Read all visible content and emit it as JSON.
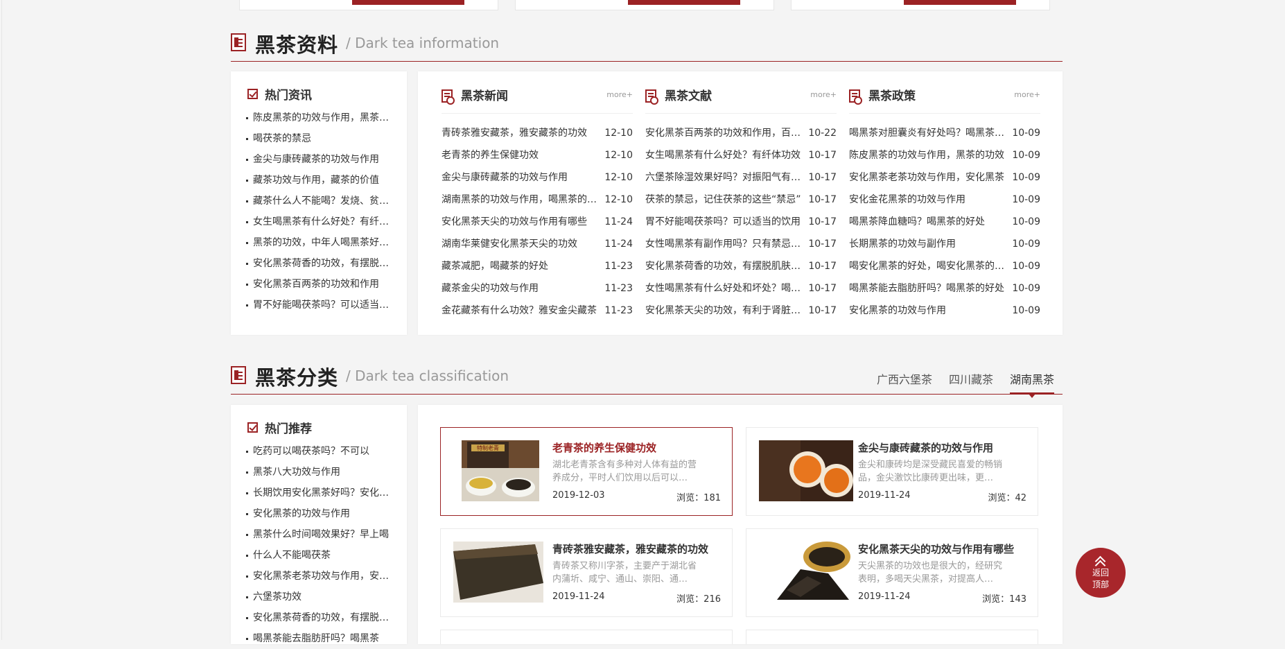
{
  "colors": {
    "accent": "#9b2224",
    "page_bg": "#f4f4f4",
    "muted": "#999999"
  },
  "info_section": {
    "title": "黑茶资料",
    "subtitle": "/ Dark tea information"
  },
  "hot_news": {
    "title": "热门资讯",
    "items": [
      "陈皮黑茶的功效与作用，黑茶怎么喝",
      "喝茯茶的禁忌",
      "金尖与康砖藏茶的功效与作用",
      "藏茶功效与作用，藏茶的价值",
      "藏茶什么人不能喝？发烧、贫血人群",
      "女生喝黑茶有什么好处？有纤体功效",
      "黑茶的功效，中年人喝黑茶好处多",
      "安化黑茶荷香的功效，有摆脱烦恼",
      "安化黑茶百两茶的功效和作用",
      "胃不好能喝茯茶吗？可以适当饮用"
    ]
  },
  "news_columns": [
    {
      "title": "黑茶新闻",
      "more": "more+",
      "items": [
        {
          "title": "青砖茶雅安藏茶，雅安藏茶的功效",
          "date": "12-10"
        },
        {
          "title": "老青茶的养生保健功效",
          "date": "12-10"
        },
        {
          "title": "金尖与康砖藏茶的功效与作用",
          "date": "12-10"
        },
        {
          "title": "湖南黑茶的功效与作用，喝黑茶的好处",
          "date": "12-10"
        },
        {
          "title": "安化黑茶天尖的功效与作用有哪些",
          "date": "11-24"
        },
        {
          "title": "湖南华莱健安化黑茶天尖的功效",
          "date": "11-24"
        },
        {
          "title": "藏茶减肥，喝藏茶的好处",
          "date": "11-23"
        },
        {
          "title": "藏茶金尖的功效与作用",
          "date": "11-23"
        },
        {
          "title": "金花藏茶有什么功效？雅安金尖藏茶",
          "date": "11-23"
        }
      ]
    },
    {
      "title": "黑茶文献",
      "more": "more+",
      "items": [
        {
          "title": "安化黑茶百两茶的功效和作用，百两茶",
          "date": "10-22"
        },
        {
          "title": "女生喝黑茶有什么好处？有纤体功效",
          "date": "10-17"
        },
        {
          "title": "六堡茶除湿效果好吗？对振阳气有帮助",
          "date": "10-17"
        },
        {
          "title": "茯茶的禁忌，记住茯茶的这些“禁忌”",
          "date": "10-17"
        },
        {
          "title": "胃不好能喝茯茶吗？可以适当的饮用",
          "date": "10-17"
        },
        {
          "title": "女性喝黑茶有副作用吗？只有禁忌人群",
          "date": "10-17"
        },
        {
          "title": "安化黑茶荷香的功效，有摆脱肌肤问题",
          "date": "10-17"
        },
        {
          "title": "女性喝黑茶有什么好处和坏处？喝黑茶",
          "date": "10-17"
        },
        {
          "title": "安化黑茶天尖的功效，有利于肾脏健康",
          "date": "10-17"
        }
      ]
    },
    {
      "title": "黑茶政策",
      "more": "more+",
      "items": [
        {
          "title": "喝黑茶对胆囊炎有好处吗？喝黑茶的好处",
          "date": "10-09"
        },
        {
          "title": "陈皮黑茶的功效与作用，黑茶的功效",
          "date": "10-09"
        },
        {
          "title": "安化黑茶老茶功效与作用，安化黑茶",
          "date": "10-09"
        },
        {
          "title": "安化金花黑茶的功效与作用",
          "date": "10-09"
        },
        {
          "title": "喝黑茶降血糖吗？喝黑茶的好处",
          "date": "10-09"
        },
        {
          "title": "长期黑茶的功效与副作用",
          "date": "10-09"
        },
        {
          "title": "喝安化黑茶的好处，喝安化黑茶的功效",
          "date": "10-09"
        },
        {
          "title": "喝黑茶能去脂肪肝吗？喝黑茶的好处",
          "date": "10-09"
        },
        {
          "title": "安化黑茶的功效与作用",
          "date": "10-09"
        }
      ]
    }
  ],
  "class_section": {
    "title": "黑茶分类",
    "subtitle": "/ Dark tea classification",
    "tabs": [
      "广西六堡茶",
      "四川藏茶",
      "湖南黑茶"
    ],
    "active_tab": "湖南黑茶"
  },
  "hot_recommend": {
    "title": "热门推荐",
    "items": [
      "吃药可以喝茯茶吗？不可以",
      "黑茶八大功效与作用",
      "长期饮用安化黑茶好吗？安化黑茶",
      "安化黑茶的功效与作用",
      "黑茶什么时间喝效果好？早上喝",
      "什么人不能喝茯茶",
      "安化黑茶老茶功效与作用，安化黑茶",
      "六堡茶功效",
      "安化黑茶荷香的功效，有摆脱烦恼",
      "喝黑茶能去脂肪肝吗？喝黑茶"
    ]
  },
  "articles": [
    {
      "title": "老青茶的养生保健功效",
      "desc": "湖北老青茶含有多种对人体有益的营养成分，平时人们饮用以后可以…",
      "date": "2019-12-03",
      "views": "浏览：181",
      "thumb_label": "特制老青"
    },
    {
      "title": "金尖与康砖藏茶的功效与作用",
      "desc": "金尖和康砖均是深受藏民喜爱的畅销品，金尖激饮比康砖更出味，更…",
      "date": "2019-11-24",
      "views": "浏览：42"
    },
    {
      "title": "青砖茶雅安藏茶，雅安藏茶的功效",
      "desc": "青砖茶又称川字茶，主要产于湖北省内蒲圻、咸宁、通山、崇阳、通…",
      "date": "2019-11-24",
      "views": "浏览：216"
    },
    {
      "title": "安化黑茶天尖的功效与作用有哪些",
      "desc": "天尖黑茶的功效也是很大的，经研究表明，多喝天尖黑茶，对提高人…",
      "date": "2019-11-24",
      "views": "浏览：143"
    }
  ],
  "back_to_top": {
    "line1": "返回",
    "line2": "顶部"
  }
}
